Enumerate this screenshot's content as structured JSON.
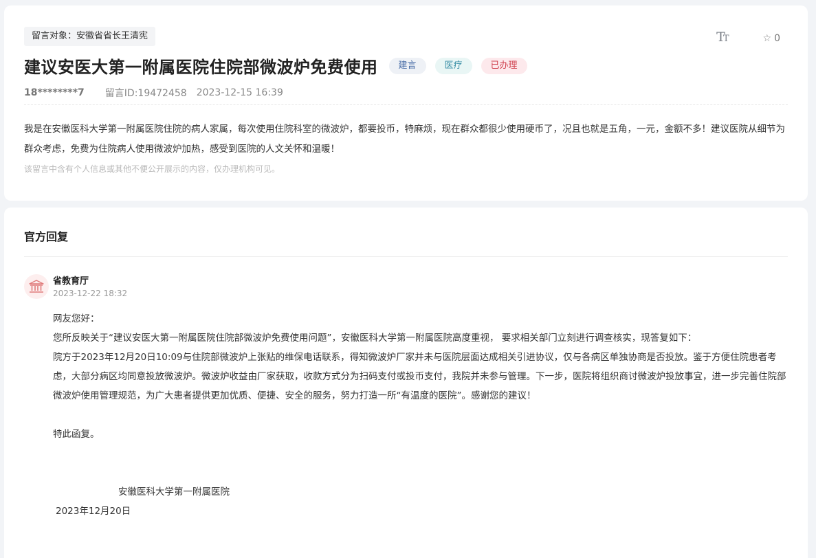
{
  "message": {
    "target": "留言对象：安徽省省长王清宪",
    "title": "建议安医大第一附属医院住院部微波炉免费使用",
    "badges": {
      "type": "建言",
      "domain": "医疗",
      "status": "已办理"
    },
    "favorite_count": "0",
    "author": "18********7",
    "message_id": "留言ID:19472458",
    "time": "2023-12-15 16:39",
    "content": "我是在安徽医科大学第一附属医院住院的病人家属，每次使用住院科室的微波炉，都要投币，特麻烦，现在群众都很少使用硬币了，况且也就是五角，一元，金额不多！建议医院从细节为群众考虑，免费为住院病人使用微波炉加热，感受到医院的人文关怀和温暖！",
    "privacy_note": "该留言中含有个人信息或其他不便公开展示的内容，仅办理机构可见。"
  },
  "reply": {
    "section_title": "官方回复",
    "department": "省教育厅",
    "time": "2023-12-22 18:32",
    "greeting": "网友您好：",
    "paragraph1": "您所反映关于“建议安医大第一附属医院住院部微波炉免费使用问题”，安徽医科大学第一附属医院高度重视， 要求相关部门立刻进行调查核实，现答复如下：",
    "paragraph2": "院方于2023年12月20日10:09与住院部微波炉上张贴的维保电话联系，得知微波炉厂家并未与医院层面达成相关引进协议，仅与各病区单独协商是否投放。鉴于方便住院患者考虑，大部分病区均同意投放微波炉。微波炉收益由厂家获取，收款方式分为扫码支付或投币支付，我院并未参与管理。下一步，医院将组织商讨微波炉投放事宜，进一步完善住院部微波炉使用管理规范，为广大患者提供更加优质、便捷、安全的服务，努力打造一所“有温度的医院”。感谢您的建议！",
    "closing": "特此函复。",
    "signature": "安徽医科大学第一附属医院",
    "sign_date": "2023年12月20日"
  },
  "icons": {
    "font_size": "font-size-icon",
    "favorite": "star-outline-icon",
    "avatar": "government-building-icon"
  },
  "colors": {
    "badge_type_text": "#4a6ea8",
    "badge_domain_text": "#3a8fa6",
    "badge_status_text": "#d0424f",
    "avatar_icon": "#e07a7a"
  }
}
